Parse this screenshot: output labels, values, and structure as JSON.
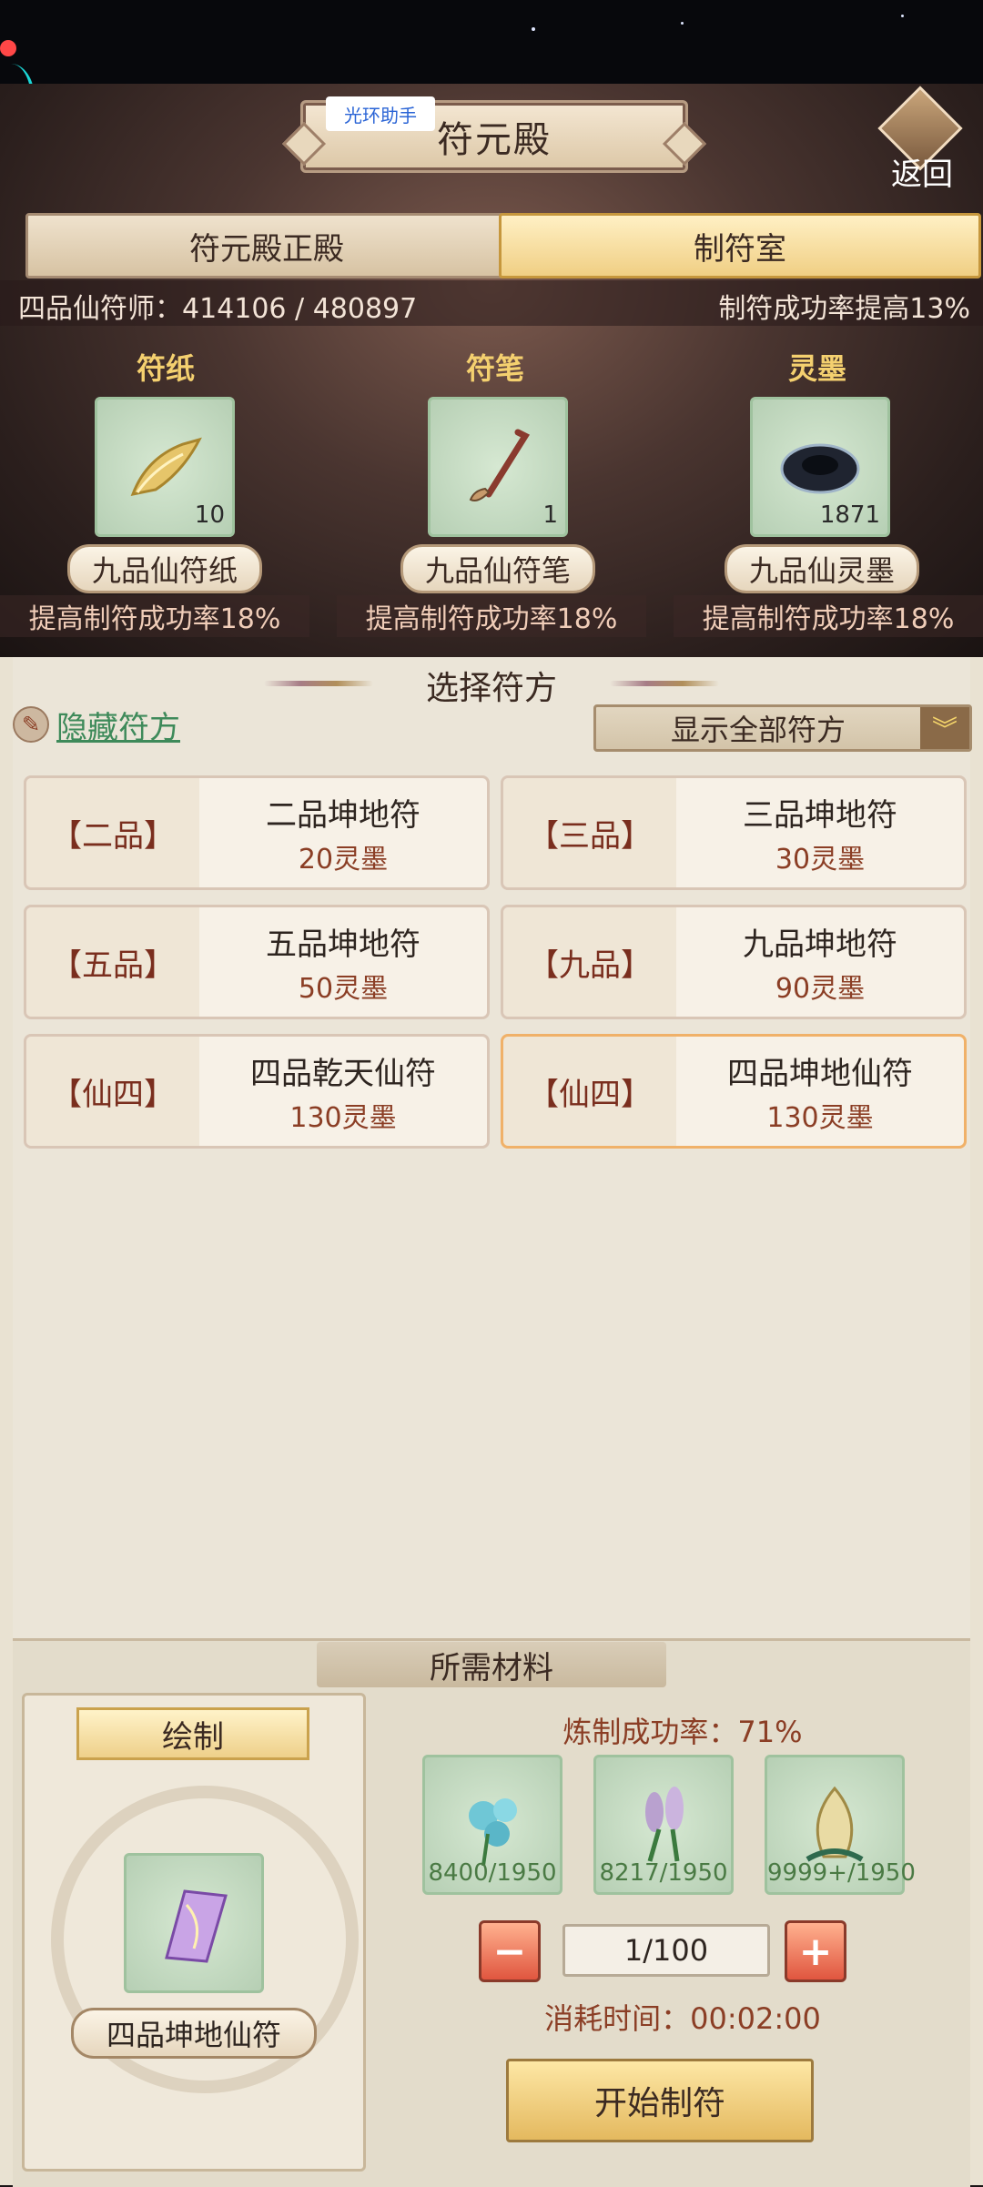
{
  "colors": {
    "accent_gold": "#f4d06f",
    "text_brown": "#8b3e25",
    "link_green": "#3e8a5a",
    "selected_border": "#f0b169"
  },
  "header": {
    "helper_badge": "光环助手",
    "title": "符元殿",
    "back_label": "返回"
  },
  "tabs": [
    {
      "label": "符元殿正殿",
      "active": false
    },
    {
      "label": "制符室",
      "active": true
    }
  ],
  "rank": {
    "text": "四品仙符师：414106 / 480897",
    "rate": "制符成功率提高13%"
  },
  "tools": [
    {
      "header": "符纸",
      "icon": "scroll-paper-icon",
      "count": "10",
      "name": "九品仙符纸",
      "bonus": "提高制符成功率18%"
    },
    {
      "header": "符笔",
      "icon": "brush-icon",
      "count": "1",
      "name": "九品仙符笔",
      "bonus": "提高制符成功率18%"
    },
    {
      "header": "灵墨",
      "icon": "ink-stone-icon",
      "count": "1871",
      "name": "九品仙灵墨",
      "bonus": "提高制符成功率18%"
    }
  ],
  "select": {
    "title": "选择符方",
    "hide_label": "隐藏符方",
    "filter_label": "显示全部符方"
  },
  "recipes": [
    {
      "grade": "【二品】",
      "name": "二品坤地符",
      "cost": "20灵墨",
      "selected": false
    },
    {
      "grade": "【三品】",
      "name": "三品坤地符",
      "cost": "30灵墨",
      "selected": false
    },
    {
      "grade": "【五品】",
      "name": "五品坤地符",
      "cost": "50灵墨",
      "selected": false
    },
    {
      "grade": "【九品】",
      "name": "九品坤地符",
      "cost": "90灵墨",
      "selected": false
    },
    {
      "grade": "【仙四】",
      "name": "四品乾天仙符",
      "cost": "130灵墨",
      "selected": false
    },
    {
      "grade": "【仙四】",
      "name": "四品坤地仙符",
      "cost": "130灵墨",
      "selected": true
    }
  ],
  "materials": {
    "title": "所需材料",
    "draw_label": "绘制",
    "draw_item_name": "四品坤地仙符",
    "success_rate": "炼制成功率：71%",
    "items": [
      {
        "icon": "blue-flower-icon",
        "count": "8400/1950"
      },
      {
        "icon": "purple-flower-icon",
        "count": "8217/1950"
      },
      {
        "icon": "golden-bud-icon",
        "count": "9999+/1950"
      }
    ],
    "quantity": "1/100",
    "time": "消耗时间：00:02:00",
    "start_label": "开始制符"
  }
}
